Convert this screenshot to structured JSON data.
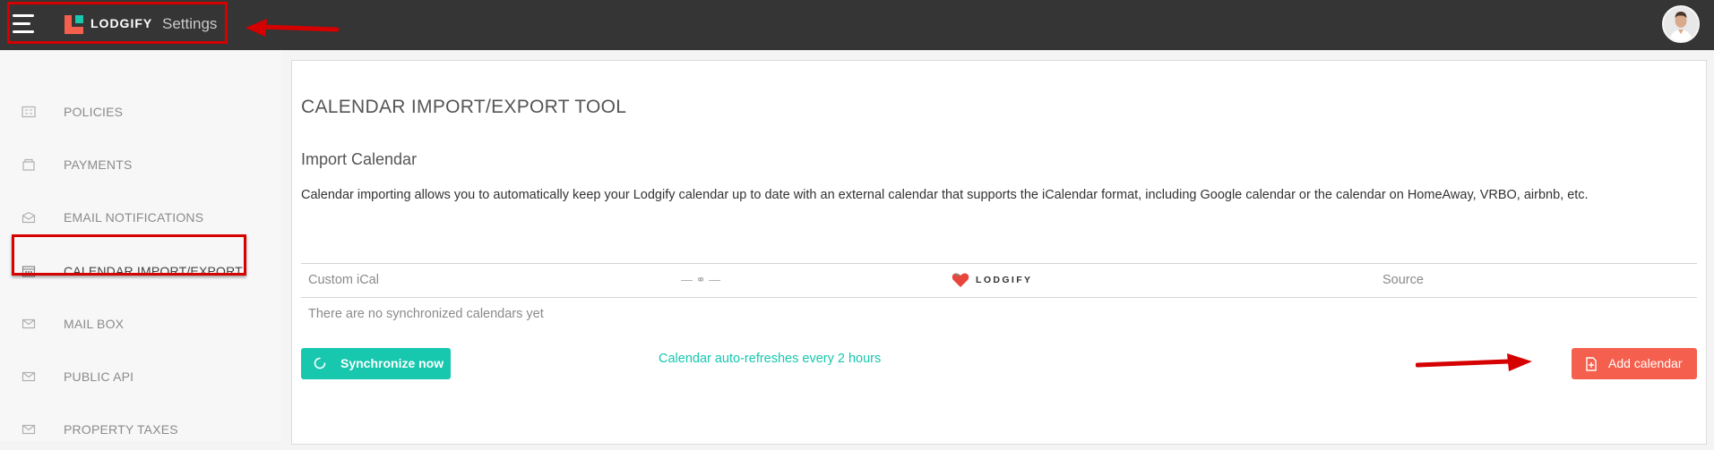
{
  "header": {
    "brand": "LODGIFY",
    "section_title": "Settings"
  },
  "sidebar": {
    "items": [
      {
        "label": "POLICIES",
        "icon": "policies-icon"
      },
      {
        "label": "PAYMENTS",
        "icon": "payments-icon"
      },
      {
        "label": "EMAIL NOTIFICATIONS",
        "icon": "email-icon"
      },
      {
        "label": "CALENDAR IMPORT/EXPORT",
        "icon": "calendar-icon",
        "active": true
      },
      {
        "label": "MAIL BOX",
        "icon": "mailbox-icon"
      },
      {
        "label": "PUBLIC API",
        "icon": "api-icon"
      },
      {
        "label": "PROPERTY TAXES",
        "icon": "taxes-icon"
      }
    ]
  },
  "main": {
    "title": "CALENDAR IMPORT/EXPORT TOOL",
    "import_title": "Import Calendar",
    "description": "Calendar importing allows you to automatically keep your Lodgify calendar up to date with an external calendar that supports the iCalendar format, including Google calendar or the calendar on HomeAway, VRBO, airbnb, etc.",
    "table": {
      "col_custom": "Custom iCal",
      "col_link": "— ⚭ —",
      "col_lodgify": "LODGIFY",
      "col_source": "Source",
      "empty_message": "There are no synchronized calendars yet"
    },
    "sync_button": "Synchronize now",
    "auto_refresh": "Calendar auto-refreshes every 2 hours",
    "add_button": "Add calendar"
  },
  "colors": {
    "topbar": "#353535",
    "accent_teal": "#17c7ae",
    "accent_coral": "#f5604e",
    "annotation_red": "#d50000"
  }
}
